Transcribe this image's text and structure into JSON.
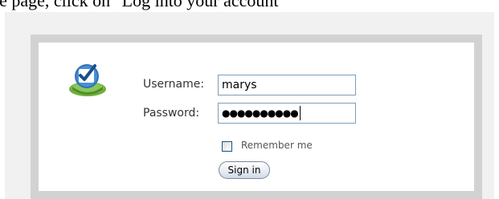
{
  "caption": {
    "text": "the page, click on \"Log into your account\""
  },
  "login": {
    "logo_icon": "checkmark-badge-icon",
    "username_label": "Username:",
    "username_value": "marys",
    "password_label": "Password:",
    "password_mask": "●●●●●●●●●●",
    "remember_label": "Remember me",
    "remember_checked": false,
    "signin_label": "Sign in"
  },
  "colors": {
    "logo_blue": "#2e73b8",
    "logo_green": "#7ab648",
    "frame_gray": "#d2d2d2",
    "panel_gray": "#f1f1f1",
    "input_border": "#7f9db9"
  }
}
